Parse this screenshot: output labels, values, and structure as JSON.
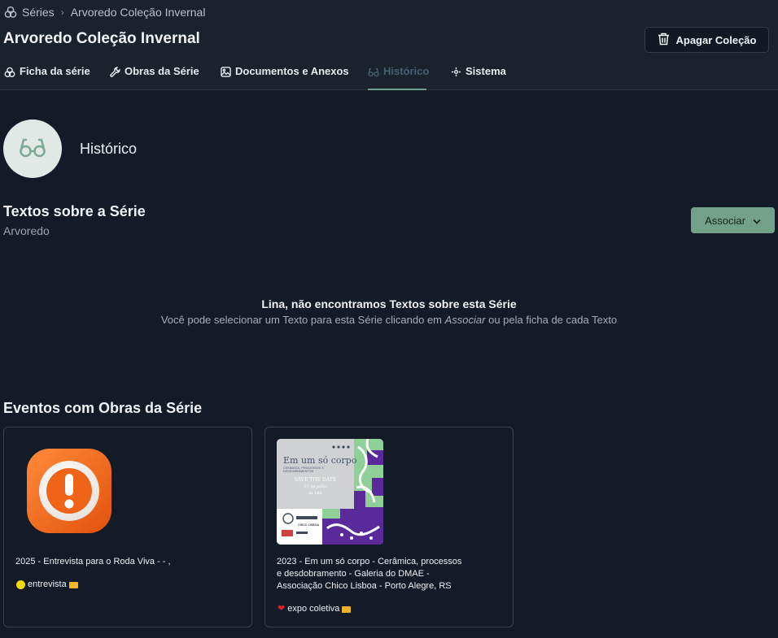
{
  "breadcrumb": {
    "root": "Séries",
    "current": "Arvoredo Coleção Invernal"
  },
  "page": {
    "title": "Arvoredo Coleção Invernal",
    "delete_label": "Apagar Coleção"
  },
  "tabs": [
    {
      "label": "Ficha da série",
      "icon": "circles-icon"
    },
    {
      "label": "Obras da Série",
      "icon": "wrench-icon"
    },
    {
      "label": "Documentos e Anexos",
      "icon": "image-icon"
    },
    {
      "label": "Histórico",
      "icon": "glasses-icon",
      "active": true
    },
    {
      "label": "Sistema",
      "icon": "cog-icon"
    }
  ],
  "history": {
    "label": "Histórico",
    "icon": "glasses-icon"
  },
  "texts_section": {
    "title": "Textos sobre a Série",
    "subtitle": "Arvoredo",
    "associate_label": "Associar",
    "empty_title": "Lina, não encontramos Textos sobre esta Série",
    "empty_text_before": "Você pode selecionar um Texto para esta Série clicando em ",
    "empty_text_em": "Associar",
    "empty_text_after": " ou pela ficha de cada Texto"
  },
  "events_section": {
    "title": "Eventos com Obras da Série",
    "cards": [
      {
        "lines": [
          "2025 - Entrevista para o Roda Viva -  - ,"
        ],
        "tag": "entrevista",
        "tag_icon": "yellow-dot-icon",
        "image_icon": "alert-icon"
      },
      {
        "lines": [
          "2023 - Em um só corpo - Cerâmica, processos",
          "e desdobramento - Galeria do DMAE -",
          "Associação Chico Lisboa - Porto Alegre, RS"
        ],
        "tag": "expo coletiva",
        "tag_icon": "heart-icon",
        "poster": {
          "title": "Em um só corpo",
          "subtitle": "cerâmica, processos e desdobramentos",
          "save": "SAVE THE DATE",
          "date": "07 de julho",
          "time": "às 18h",
          "logo": "CHICO LISBOA"
        }
      }
    ]
  },
  "colors": {
    "background": "#131a28",
    "header": "#1a222e",
    "accent": "#72a089"
  }
}
